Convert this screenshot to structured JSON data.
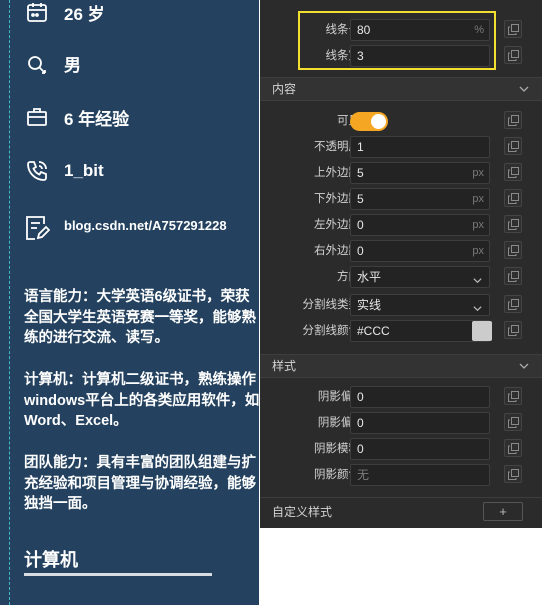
{
  "resume": {
    "info": [
      {
        "icon": "calendar-icon",
        "text": "26 岁"
      },
      {
        "icon": "gender-icon",
        "text": "男"
      },
      {
        "icon": "briefcase-icon",
        "text": "6 年经验"
      },
      {
        "icon": "phone-icon",
        "text": "1_bit"
      },
      {
        "icon": "edit-document-icon",
        "text": "blog.csdn.net/A757291228"
      }
    ],
    "paragraphs": [
      "语言能力：大学英语6级证书，荣获全国大学生英语竞赛一等奖，能够熟练的进行交流、读写。",
      "计算机：计算机二级证书，熟练操作windows平台上的各类应用软件，如Word、Excel。",
      "团队能力：具有丰富的团队组建与扩充经验和项目管理与协调经验，能够独挡一面。"
    ],
    "section_title": "计算机"
  },
  "panel": {
    "line": {
      "length_label": "线条长",
      "length_value": "80",
      "length_unit": "%",
      "width_label": "线条宽",
      "width_value": "3"
    },
    "content_section": {
      "title": "内容",
      "visible_label": "可见",
      "visible_on": true,
      "opacity_label": "不透明度",
      "opacity_value": "1",
      "margin_top_label": "上外边距",
      "margin_top_value": "5",
      "margin_top_unit": "px",
      "margin_bottom_label": "下外边距",
      "margin_bottom_value": "5",
      "margin_bottom_unit": "px",
      "margin_left_label": "左外边距",
      "margin_left_value": "0",
      "margin_left_unit": "px",
      "margin_right_label": "右外边距",
      "margin_right_value": "0",
      "margin_right_unit": "px",
      "direction_label": "方向",
      "direction_value": "水平",
      "divider_type_label": "分割线类型",
      "divider_type_value": "实线",
      "divider_color_label": "分割线颜色",
      "divider_color_value": "#CCC"
    },
    "style_section": {
      "title": "样式",
      "shadow_x_label": "阴影偏X",
      "shadow_x_value": "0",
      "shadow_y_label": "阴影偏Y",
      "shadow_y_value": "0",
      "shadow_blur_label": "阴影模糊",
      "shadow_blur_value": "0",
      "shadow_color_label": "阴影颜色",
      "shadow_color_value": "无"
    },
    "custom_style": {
      "title": "自定义样式",
      "add_label": "+"
    }
  },
  "colors": {
    "resume_bg": "#24425f",
    "panel_bg": "#2b2b2b",
    "toggle_on": "#f5a623",
    "highlight_border": "#f2e030",
    "divider_swatch": "#cccccc"
  }
}
